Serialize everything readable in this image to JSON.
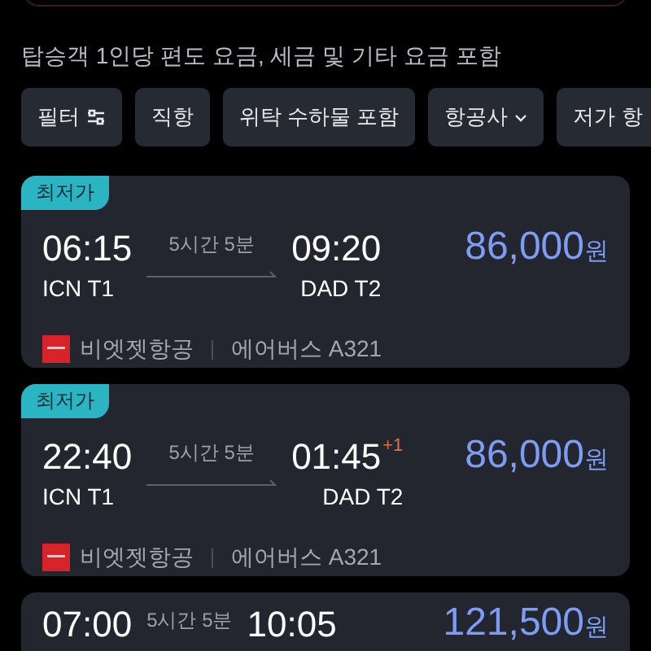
{
  "caption": "탑승객 1인당 편도 요금, 세금 및 기타 요금 포함",
  "chips": [
    {
      "label": "필터",
      "kind": "filter"
    },
    {
      "label": "직항",
      "kind": "plain"
    },
    {
      "label": "위탁 수하물 포함",
      "kind": "plain"
    },
    {
      "label": "항공사",
      "kind": "dropdown"
    },
    {
      "label": "저가 항",
      "kind": "plain"
    }
  ],
  "flights": [
    {
      "badge": "최저가",
      "depart": "06:15",
      "duration": "5시간 5분",
      "arrive": "09:20",
      "from": "ICN T1",
      "to": "DAD T2",
      "price": "86,000",
      "currency": "원",
      "airline": "비엣젯항공",
      "aircraft": "에어버스 A321"
    },
    {
      "badge": "최저가",
      "depart": "22:40",
      "duration": "5시간 5분",
      "arrive": "01:45",
      "plus_days": "+1",
      "from": "ICN T1",
      "to": "DAD T2",
      "price": "86,000",
      "currency": "원",
      "airline": "비엣젯항공",
      "aircraft": "에어버스 A321"
    },
    {
      "depart": "07:00",
      "duration": "5시간 5분",
      "arrive": "10:05",
      "price": "121,500",
      "currency": "원"
    }
  ]
}
